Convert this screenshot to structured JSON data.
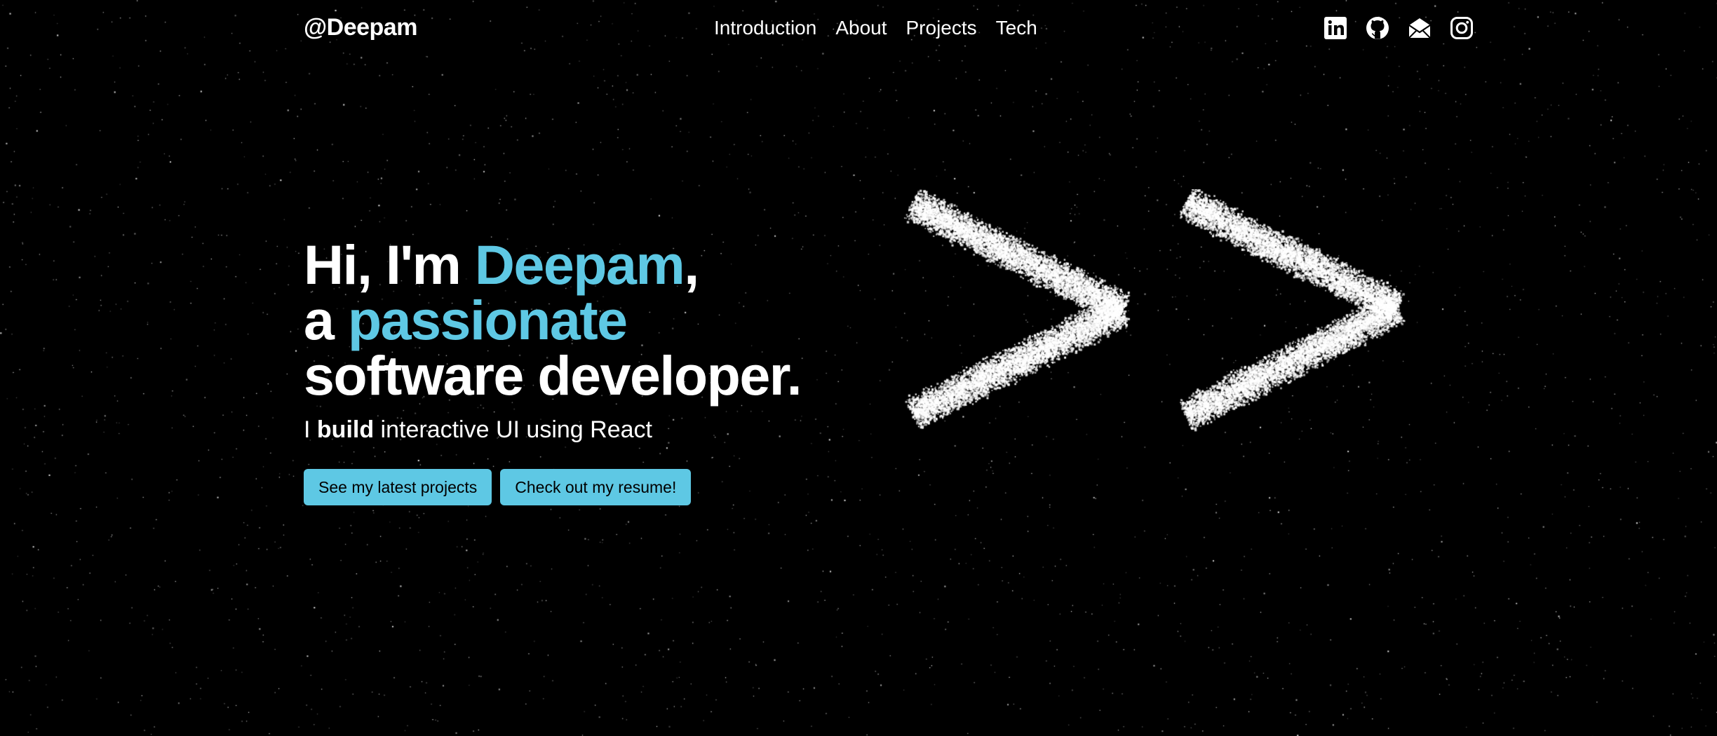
{
  "brand": "@Deepam",
  "nav": {
    "items": [
      {
        "label": "Introduction"
      },
      {
        "label": "About"
      },
      {
        "label": "Projects"
      },
      {
        "label": "Tech"
      }
    ]
  },
  "social": {
    "items": [
      {
        "icon": "linkedin-icon"
      },
      {
        "icon": "github-icon"
      },
      {
        "icon": "mail-icon"
      },
      {
        "icon": "instagram-icon"
      }
    ]
  },
  "hero": {
    "line1_prefix": "Hi, I'm ",
    "line1_name": "Deepam",
    "line1_suffix": ",",
    "line2_prefix": "a ",
    "line2_accent": "passionate",
    "line3": "software developer.",
    "tagline_prefix": "I ",
    "tagline_bold": "build",
    "tagline_suffix": " interactive UI using React"
  },
  "buttons": {
    "projects": "See my latest projects",
    "resume": "Check out my resume!"
  },
  "colors": {
    "accent": "#5ec8e4",
    "background": "#000000",
    "text": "#ffffff"
  },
  "decoration": {
    "particle_shape": "double-chevron"
  }
}
